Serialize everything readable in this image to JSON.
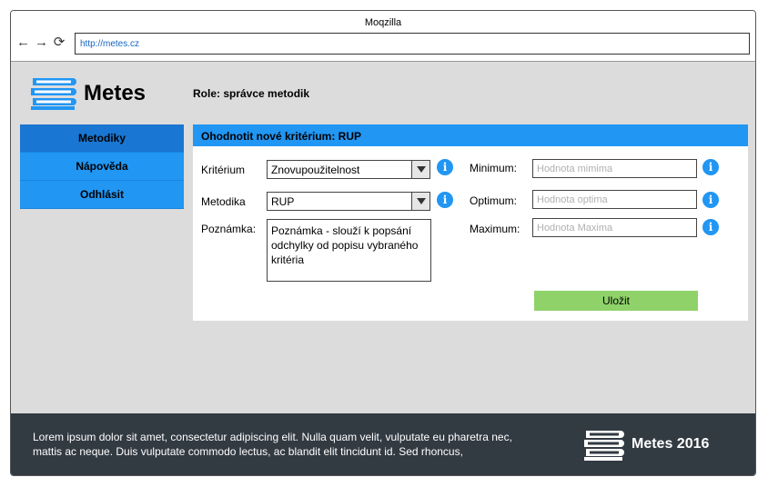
{
  "browser": {
    "title": "Moqzilla",
    "url": "http://metes.cz",
    "icons": [
      "back-arrow",
      "forward-arrow",
      "reload"
    ]
  },
  "header": {
    "brand": "Metes",
    "role": "Role: správce metodik"
  },
  "sidebar": {
    "items": [
      {
        "label": "Metodiky"
      },
      {
        "label": "Nápověda"
      },
      {
        "label": "Odhlásit"
      }
    ]
  },
  "form": {
    "title": "Ohodnotit nové kritérium: RUP",
    "kriterium_label": "Kritérium",
    "kriterium_value": "Znovupoužitelnost",
    "metodika_label": "Metodika",
    "metodika_value": "RUP",
    "poznamka_label": "Poznámka:",
    "poznamka_value": "Poznámka - slouží k popsání odchylky od popisu vybraného kritéria",
    "minimum_label": "Minimum:",
    "minimum_placeholder": "Hodnota mimima",
    "optimum_label": "Optimum:",
    "optimum_placeholder": "Hodnota optima",
    "maximum_label": "Maximum:",
    "maximum_placeholder": "Hodnota Maxima",
    "info_glyph": "i",
    "save_label": "Uložit"
  },
  "footer": {
    "text": "Lorem ipsum dolor sit amet, consectetur adipiscing elit. Nulla quam velit, vulputate eu pharetra nec, mattis ac neque. Duis vulputate commodo lectus, ac blandit elit tincidunt id. Sed rhoncus,",
    "brand": "Metes 2016"
  },
  "colors": {
    "accent": "#2196f3",
    "accent_dark": "#1976d2",
    "save": "#8fd26a",
    "footer_bg": "#323a42",
    "app_bg": "#dcdcdc"
  }
}
